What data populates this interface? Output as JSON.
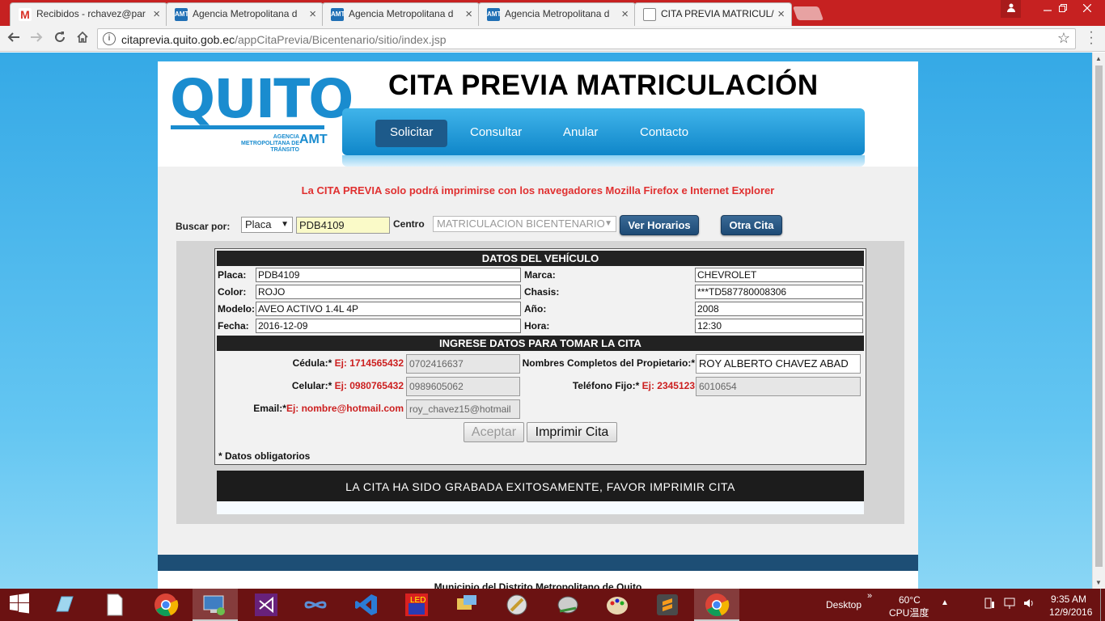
{
  "browser": {
    "tabs": [
      {
        "title": "Recibidos - rchavez@par",
        "favicon": "gmail-icon"
      },
      {
        "title": "Agencia Metropolitana d",
        "favicon": "amt-icon"
      },
      {
        "title": "Agencia Metropolitana d",
        "favicon": "amt-icon"
      },
      {
        "title": "Agencia Metropolitana d",
        "favicon": "amt-icon"
      },
      {
        "title": "CITA PREVIA MATRICUL/",
        "favicon": "document-icon"
      }
    ],
    "active_tab": 4,
    "url_host": "citaprevia.quito.gob.ec",
    "url_path": "/appCitaPrevia/Bicentenario/sitio/index.jsp",
    "close_glyph": "×",
    "accent": "#c62121"
  },
  "site": {
    "logo_text": "QUITO",
    "logo_sub": "AGENCIA METROPOLITANA DE TRÁNSITO",
    "logo_amt": "AMT",
    "title": "CITA PREVIA MATRICULACIÓN",
    "nav": [
      "Solicitar",
      "Consultar",
      "Anular",
      "Contacto"
    ],
    "nav_active": "Solicitar"
  },
  "notice": "La CITA PREVIA solo podrá imprimirse con los navegadores Mozilla Firefox e Internet Explorer",
  "search": {
    "label": "Buscar por:",
    "type_value": "Placa",
    "plate_value": "PDB4109",
    "centro_label": "Centro",
    "centro_value": "MATRICULACION BICENTENARIO",
    "ver_horarios": "Ver Horarios",
    "otra_cita": "Otra Cita"
  },
  "vehicle": {
    "header": "DATOS DEL VEHÍCULO",
    "rows": [
      {
        "l1": "Placa:",
        "v1": "PDB4109",
        "l2": "Marca:",
        "v2": "CHEVROLET"
      },
      {
        "l1": "Color:",
        "v1": "ROJO",
        "l2": "Chasis:",
        "v2": "***TD587780008306"
      },
      {
        "l1": "Modelo:",
        "v1": "AVEO ACTIVO 1.4L 4P",
        "l2": "Año:",
        "v2": "2008"
      },
      {
        "l1": "Fecha:",
        "v1": "2016-12-09",
        "l2": "Hora:",
        "v2": "12:30"
      }
    ]
  },
  "form": {
    "header": "INGRESE DATOS PARA TOMAR LA CITA",
    "cedula_label": "Cédula:*",
    "cedula_example": "Ej: 1714565432",
    "cedula_value": "0702416637",
    "nombres_label": "Nombres Completos del Propietario:*",
    "nombres_value": "ROY ALBERTO CHAVEZ ABAD",
    "celular_label": "Celular:*",
    "celular_example": "Ej: 0980765432",
    "celular_value": "0989605062",
    "telefono_label": "Teléfono Fijo:*",
    "telefono_example": "Ej: 2345123",
    "telefono_value": "6010654",
    "email_label": "Email:*",
    "email_example": "Ej: nombre@hotmail.com",
    "email_value": "roy_chavez15@hotmail",
    "aceptar": "Aceptar",
    "imprimir": "Imprimir Cita",
    "required_note": "* Datos obligatorios"
  },
  "success_message": "LA CITA HA SIDO GRABADA EXITOSAMENTE, FAVOR IMPRIMIR CITA",
  "footer": "Municipio del Distrito Metropolitano de Quito",
  "taskbar": {
    "desktop_label": "Desktop",
    "temp": "60°C",
    "cpu_label": "CPU温度",
    "time": "9:35 AM",
    "date": "12/9/2016"
  }
}
